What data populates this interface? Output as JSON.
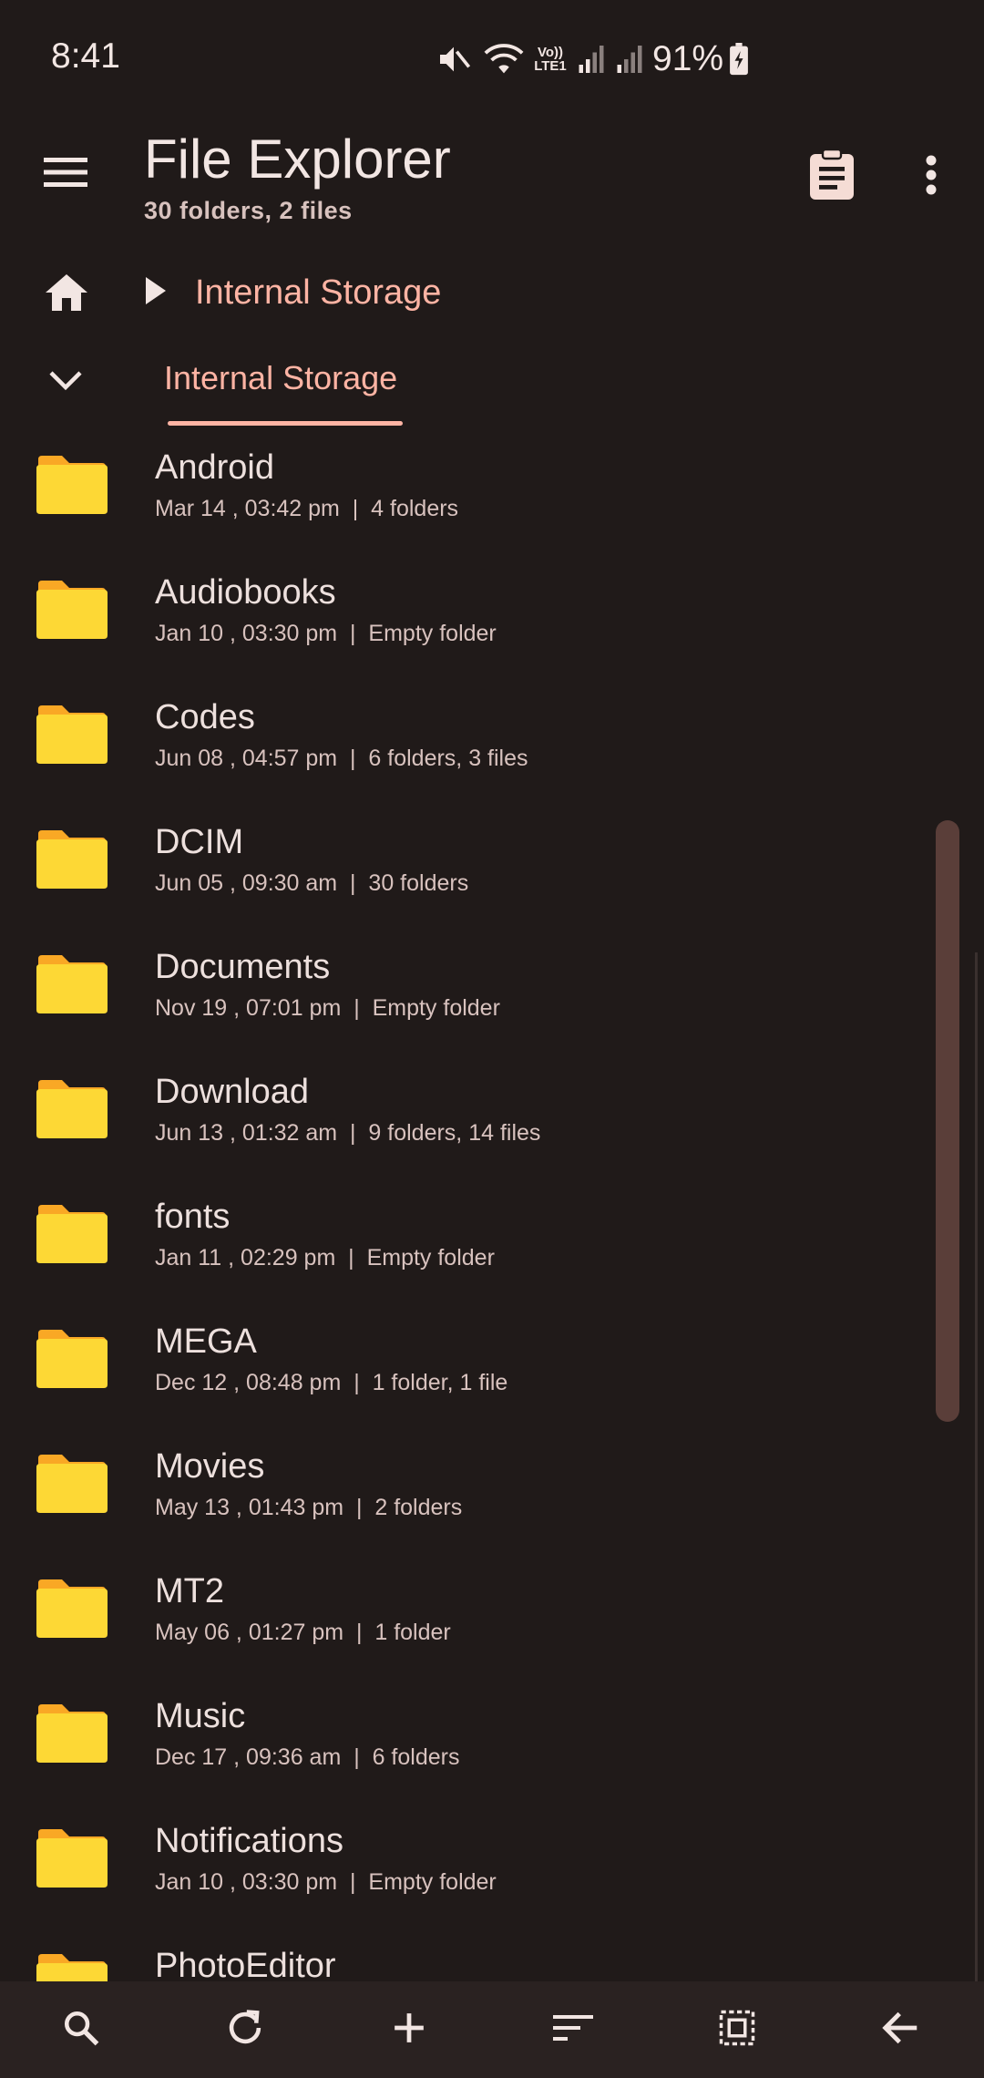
{
  "status_bar": {
    "time": "8:41",
    "battery_percent": "91%",
    "network_label": "Vo)) LTE1",
    "icons": [
      "mute-icon",
      "wifi-icon",
      "volte-icon",
      "signal-icon",
      "signal-icon",
      "battery-charging-icon"
    ]
  },
  "app_bar": {
    "title": "File Explorer",
    "subtitle": "30 folders, 2 files",
    "icons": [
      "menu-icon",
      "clipboard-icon",
      "more-vert-icon"
    ]
  },
  "breadcrumb": {
    "items": [
      "Internal Storage"
    ],
    "icons": [
      "home-icon",
      "play-arrow-icon"
    ]
  },
  "tabs": {
    "active": "Internal Storage",
    "items": [
      "Internal Storage"
    ],
    "icons": [
      "chevron-down-icon"
    ]
  },
  "files": [
    {
      "name": "Android",
      "date": "Mar 14 , 03:42 pm",
      "info": "4 folders"
    },
    {
      "name": "Audiobooks",
      "date": "Jan 10 , 03:30 pm",
      "info": "Empty folder"
    },
    {
      "name": "Codes",
      "date": "Jun 08 , 04:57 pm",
      "info": "6 folders, 3 files"
    },
    {
      "name": "DCIM",
      "date": "Jun 05 , 09:30 am",
      "info": "30 folders"
    },
    {
      "name": "Documents",
      "date": "Nov 19 , 07:01 pm",
      "info": "Empty folder"
    },
    {
      "name": "Download",
      "date": "Jun 13 , 01:32 am",
      "info": "9 folders, 14 files"
    },
    {
      "name": "fonts",
      "date": "Jan 11 , 02:29 pm",
      "info": "Empty folder"
    },
    {
      "name": "MEGA",
      "date": "Dec 12 , 08:48 pm",
      "info": "1 folder, 1 file"
    },
    {
      "name": "Movies",
      "date": "May 13 , 01:43 pm",
      "info": "2 folders"
    },
    {
      "name": "MT2",
      "date": "May 06 , 01:27 pm",
      "info": "1 folder"
    },
    {
      "name": "Music",
      "date": "Dec 17 , 09:36 am",
      "info": "6 folders"
    },
    {
      "name": "Notifications",
      "date": "Jan 10 , 03:30 pm",
      "info": "Empty folder"
    },
    {
      "name": "PhotoEditor",
      "date": "",
      "info": ""
    }
  ],
  "bottom_bar": {
    "icons": [
      "search-icon",
      "refresh-icon",
      "add-icon",
      "sort-icon",
      "select-all-icon",
      "back-arrow-icon"
    ]
  },
  "colors": {
    "background": "#201a19",
    "accent": "#ffb4a4",
    "folder": "#fdd835",
    "text_primary": "#ede0dd",
    "text_secondary": "#d8c2be",
    "bottom_bar": "#2a2221",
    "scrollbar": "#5a3e39"
  }
}
